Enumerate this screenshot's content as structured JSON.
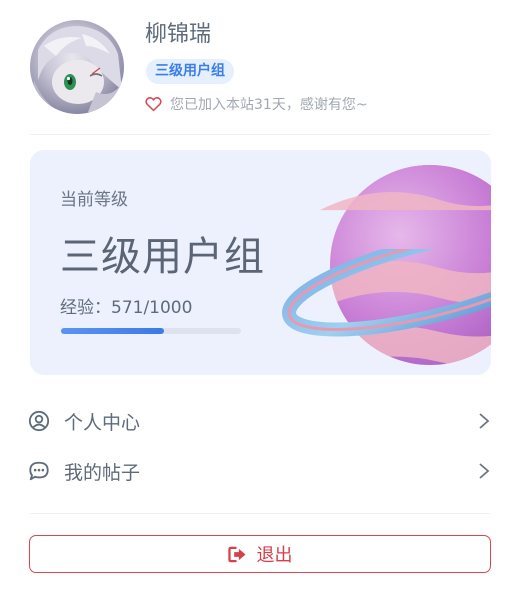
{
  "profile": {
    "username": "柳锦瑞",
    "group_badge": "三级用户组",
    "join_text": "您已加入本站31天，感谢有您~"
  },
  "level_card": {
    "label": "当前等级",
    "level_name": "三级用户组",
    "exp_text": "经验：571/1000",
    "exp_current": 571,
    "exp_max": 1000
  },
  "menu": {
    "items": [
      {
        "label": "个人中心",
        "icon": "user-circle-icon"
      },
      {
        "label": "我的帖子",
        "icon": "chat-bubble-icon"
      }
    ]
  },
  "logout": {
    "label": "退出",
    "icon": "sign-out-icon"
  },
  "colors": {
    "accent": "#3c7ee8",
    "danger": "#d9474f",
    "card_bg": "#edf1fd"
  }
}
